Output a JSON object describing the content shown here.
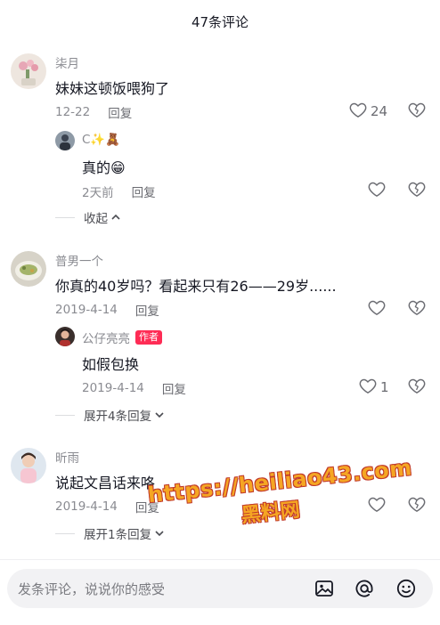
{
  "header": {
    "title": "47条评论"
  },
  "comments": [
    {
      "author": "柒月",
      "text": "妹妹这顿饭喂狗了",
      "date": "12-22",
      "reply_label": "回复",
      "likes": "24",
      "replies": [
        {
          "author": "C✨🧸",
          "text": "真的😁",
          "date": "2天前",
          "reply_label": "回复",
          "likes": ""
        }
      ],
      "expand_label": "收起"
    },
    {
      "author": "普男一个",
      "text": "你真的40岁吗？看起来只有26——29岁......",
      "date": "2019-4-14",
      "reply_label": "回复",
      "likes": "",
      "replies": [
        {
          "author": "公仔亮亮",
          "badge": "作者",
          "text": "如假包换",
          "date": "2019-4-14",
          "reply_label": "回复",
          "likes": "1"
        }
      ],
      "expand_label": "展开4条回复"
    },
    {
      "author": "昕雨",
      "text": "说起文昌话来咯",
      "date": "2019-4-14",
      "reply_label": "回复",
      "likes": "",
      "expand_label": "展开1条回复"
    }
  ],
  "watermark": {
    "line1": "https://heiliao43.com",
    "line2": "黑料网"
  },
  "input": {
    "placeholder": "发条评论，说说你的感受"
  },
  "icons": {
    "heart": "heart-outline-icon",
    "dislike": "broken-heart-icon",
    "image": "image-icon",
    "mention": "at-icon",
    "emoji": "emoji-icon"
  }
}
